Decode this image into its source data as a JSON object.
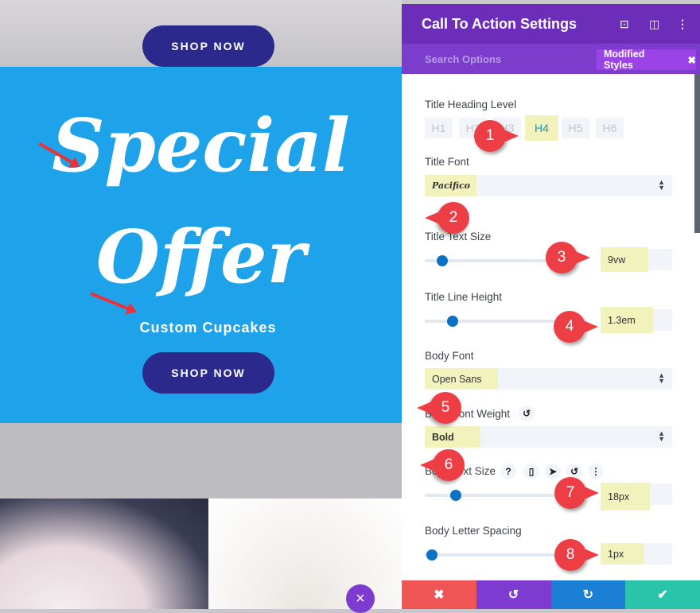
{
  "preview": {
    "shop_top": "SHOP NOW",
    "title_line1": "Special",
    "title_line2": "Offer",
    "subtitle": "Custom Cupcakes",
    "shop_main": "SHOP NOW",
    "close": "×"
  },
  "panel": {
    "title": "Call To Action Settings",
    "header_icons": [
      "focus-icon",
      "layout-icon",
      "more-icon"
    ],
    "search": "Search Options",
    "modified": "Modified Styles",
    "modified_close": "✖",
    "heading_level": {
      "label": "Title Heading Level",
      "options": [
        "H1",
        "H2",
        "H3",
        "H4",
        "H5",
        "H6"
      ],
      "selected": "H4"
    },
    "title_font": {
      "label": "Title Font",
      "value": "Pacifico"
    },
    "title_text_size": {
      "label": "Title Text Size",
      "value": "9vw"
    },
    "title_line_height": {
      "label": "Title Line Height",
      "value": "1.3em"
    },
    "body_font": {
      "label": "Body Font",
      "value": "Open Sans"
    },
    "body_font_weight": {
      "label": "Body Font Weight",
      "value": "Bold"
    },
    "body_text_size": {
      "label": "Body Text Size",
      "value": "18px",
      "help": "?"
    },
    "body_letter_spacing": {
      "label": "Body Letter Spacing",
      "value": "1px"
    },
    "footer": {
      "cancel": "✖",
      "undo": "↺",
      "redo": "↻",
      "save": "✔"
    },
    "colors": {
      "header": "#6c2eb9",
      "cancel": "#ef5555",
      "undo": "#7e3bd0",
      "redo": "#1b7fd6",
      "save": "#29c4a9"
    }
  },
  "callouts": [
    "1",
    "2",
    "3",
    "4",
    "5",
    "6",
    "7",
    "8"
  ]
}
